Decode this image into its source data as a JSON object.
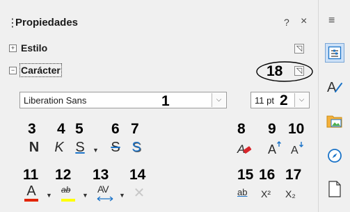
{
  "titlebar": {
    "title": "Propiedades",
    "help": "?",
    "close": "×",
    "menu": "≡"
  },
  "sections": [
    {
      "label": "Estilo",
      "expander": "+"
    },
    {
      "label": "Carácter",
      "expander": "−"
    }
  ],
  "character": {
    "font_name": "Liberation Sans",
    "font_size": "11 pt"
  },
  "tools": {
    "bold": "N",
    "italic": "K",
    "underline": "S",
    "strikethrough": "S",
    "shadow": "S",
    "font_color": "A",
    "highlight": "ab",
    "spacing": "AV",
    "clear": "✕",
    "grow": "A",
    "shrink": "A",
    "case": "ab",
    "superscript": "X²",
    "subscript": "X₂"
  },
  "callouts": {
    "c1": "1",
    "c2": "2",
    "c3": "3",
    "c4": "4",
    "c5": "5",
    "c6": "6",
    "c7": "7",
    "c8": "8",
    "c9": "9",
    "c10": "10",
    "c11": "11",
    "c12": "12",
    "c13": "13",
    "c14": "14",
    "c15": "15",
    "c16": "16",
    "c17": "17",
    "c18": "18"
  },
  "colors": {
    "font_color_bar": "#e22400",
    "highlight_bar": "#ffff00",
    "icon_blue": "#1a73c8",
    "tab_active_bg": "#cde1f7"
  },
  "tabbar": {
    "items": [
      "properties-icon",
      "styles-icon",
      "gallery-icon",
      "navigator-icon",
      "page-icon"
    ]
  }
}
